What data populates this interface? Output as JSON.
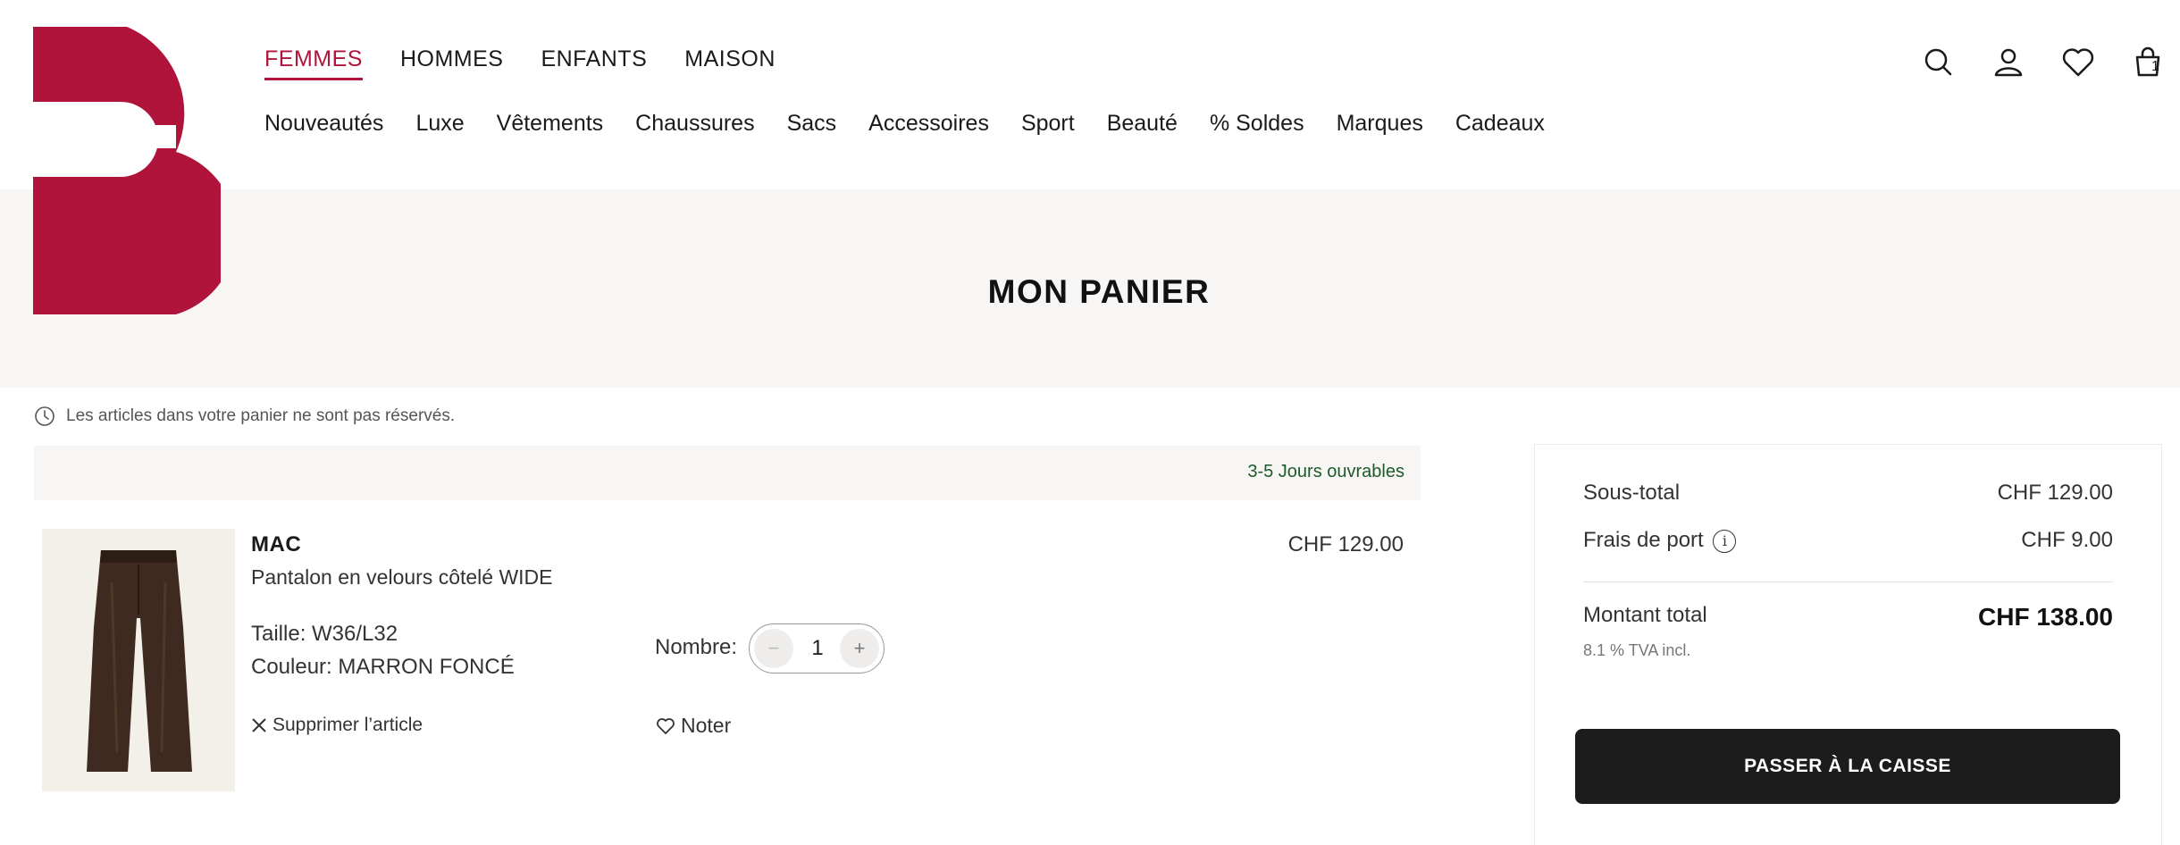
{
  "brand": {
    "logo_letter": "B",
    "accent_color": "#b0143a"
  },
  "main_nav": [
    {
      "label": "FEMMES",
      "active": true
    },
    {
      "label": "HOMMES",
      "active": false
    },
    {
      "label": "ENFANTS",
      "active": false
    },
    {
      "label": "MAISON",
      "active": false
    }
  ],
  "sub_nav": [
    "Nouveautés",
    "Luxe",
    "Vêtements",
    "Chaussures",
    "Sacs",
    "Accessoires",
    "Sport",
    "Beauté",
    "% Soldes",
    "Marques",
    "Cadeaux"
  ],
  "header_icons": {
    "search": "search-icon",
    "account": "user-icon",
    "wishlist": "heart-icon",
    "cart": "shopping-bag-icon",
    "cart_count": "1"
  },
  "page_title": "MON PANIER",
  "notice": "Les articles dans votre panier ne sont pas réservés.",
  "delivery": "3-5 Jours ouvrables",
  "item": {
    "brand": "MAC",
    "name": "Pantalon en velours côtelé WIDE",
    "size": "Taille: W36/L32",
    "color": "Couleur: MARRON FONCÉ",
    "price": "CHF 129.00",
    "quantity_label": "Nombre:",
    "quantity": "1",
    "remove_label": "Supprimer l’article",
    "wishlist_label": "Noter"
  },
  "summary": {
    "subtotal_label": "Sous-total",
    "subtotal_value": "CHF 129.00",
    "shipping_label": "Frais de port",
    "shipping_value": "CHF 9.00",
    "total_label": "Montant total",
    "total_value": "CHF 138.00",
    "vat_note": "8.1 % TVA incl.",
    "checkout_label": "PASSER À LA CAISSE"
  }
}
